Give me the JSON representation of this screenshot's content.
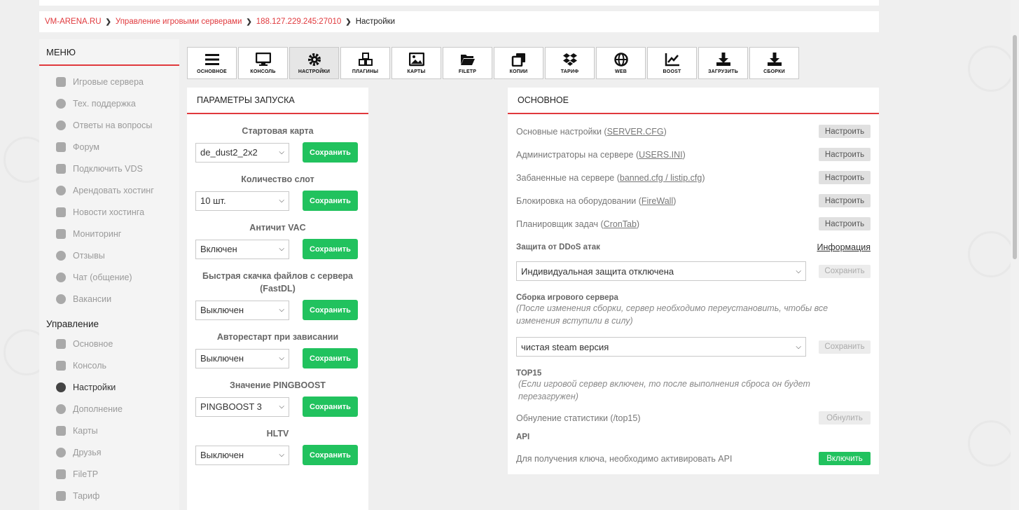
{
  "breadcrumb": {
    "items": [
      "VM-ARENA.RU",
      "Управление игровыми серверами",
      "188.127.229.245:27010"
    ],
    "current": "Настройки"
  },
  "sidebar": {
    "menu_title": "МЕНЮ",
    "menu_items": [
      {
        "label": "Игровые сервера",
        "icon": "gamepad-icon"
      },
      {
        "label": "Тех. поддержка",
        "icon": "lifebuoy-icon"
      },
      {
        "label": "Ответы на вопросы",
        "icon": "question-icon"
      },
      {
        "label": "Форум",
        "icon": "forum-icon"
      },
      {
        "label": "Подключить VDS",
        "icon": "gamepad-icon"
      },
      {
        "label": "Арендовать хостинг",
        "icon": "globe-icon"
      },
      {
        "label": "Новости хостинга",
        "icon": "newspaper-icon"
      },
      {
        "label": "Мониторинг",
        "icon": "monitor-icon"
      },
      {
        "label": "Отзывы",
        "icon": "comments-icon"
      },
      {
        "label": "Чат (общение)",
        "icon": "comments-icon"
      },
      {
        "label": "Вакансии",
        "icon": "comments-icon"
      }
    ],
    "manage_title": "Управление",
    "manage_items": [
      {
        "label": "Основное",
        "icon": "list-icon"
      },
      {
        "label": "Консоль",
        "icon": "monitor-icon"
      },
      {
        "label": "Настройки",
        "icon": "gear-icon",
        "active": true
      },
      {
        "label": "Дополнение",
        "icon": "cubes-icon"
      },
      {
        "label": "Карты",
        "icon": "image-icon"
      },
      {
        "label": "Друзья",
        "icon": "user-plus-icon"
      },
      {
        "label": "FileTP",
        "icon": "folder-icon"
      },
      {
        "label": "Тариф",
        "icon": "dropbox-icon"
      }
    ]
  },
  "toolbar": [
    {
      "label": "ОСНОВНОЕ",
      "icon": "bars-icon"
    },
    {
      "label": "КОНСОЛЬ",
      "icon": "monitor-icon"
    },
    {
      "label": "НАСТРОЙКИ",
      "icon": "gear-icon",
      "active": true
    },
    {
      "label": "ПЛАГИНЫ",
      "icon": "cubes-icon"
    },
    {
      "label": "КАРТЫ",
      "icon": "image-icon"
    },
    {
      "label": "FILETP",
      "icon": "folder-open-icon"
    },
    {
      "label": "КОПИИ",
      "icon": "copy-icon"
    },
    {
      "label": "ТАРИФ",
      "icon": "dropbox-icon"
    },
    {
      "label": "WEB",
      "icon": "globe-icon"
    },
    {
      "label": "BOOST",
      "icon": "chart-line-icon"
    },
    {
      "label": "ЗАГРУЗИТЬ",
      "icon": "download-icon"
    },
    {
      "label": "СБОРКИ",
      "icon": "download-icon"
    }
  ],
  "launch": {
    "title": "ПАРАМЕТРЫ ЗАПУСКА",
    "save_label": "Сохранить",
    "fields": [
      {
        "title": "Стартовая карта",
        "value": "de_dust2_2x2"
      },
      {
        "title": "Количество слот",
        "value": "10 шт."
      },
      {
        "title": "Античит VAC",
        "value": "Включен"
      },
      {
        "title": "Быстрая скачка файлов с сервера (FastDL)",
        "value": "Выключен"
      },
      {
        "title": "Авторестарт при зависании",
        "value": "Выключен"
      },
      {
        "title": "Значение PINGBOOST",
        "value": "PINGBOOST 3"
      },
      {
        "title": "HLTV",
        "value": "Выключен"
      }
    ]
  },
  "main": {
    "title": "ОСНОВНОЕ",
    "configure_label": "Настроить",
    "rows": [
      {
        "text": "Основные настройки (",
        "link": "SERVER.CFG",
        "tail": ")"
      },
      {
        "text": "Администраторы на сервере (",
        "link": "USERS.INI",
        "tail": ")"
      },
      {
        "text": "Забаненные на сервере (",
        "link": "banned.cfg / listip.cfg",
        "tail": ")"
      },
      {
        "text": "Блокировка на оборудовании (",
        "link": "FireWall",
        "tail": ")"
      },
      {
        "text": "Планировщик задач (",
        "link": "CronTab",
        "tail": ")"
      }
    ],
    "ddos": {
      "title": "Защита от DDoS атак",
      "info_link": "Информация",
      "value": "Индивидуальная защита отключена",
      "save_label": "Сохранить"
    },
    "build": {
      "title": "Сборка игрового сервера",
      "note": "(После изменения сборки, сервер необходимо переустановить, чтобы все изменения вступили в силу)",
      "value": "чистая steam версия",
      "save_label": "Сохранить"
    },
    "top15": {
      "title": "TOP15",
      "note": "(Если игровой сервер включен, то после выполнения сброса он будет перезагружен)",
      "reset_text": "Обнуление статистики (/top15)",
      "reset_label": "Обнулить"
    },
    "api": {
      "title": "API",
      "text": "Для получения ключа, необходимо активировать API",
      "enable_label": "Включить"
    }
  }
}
